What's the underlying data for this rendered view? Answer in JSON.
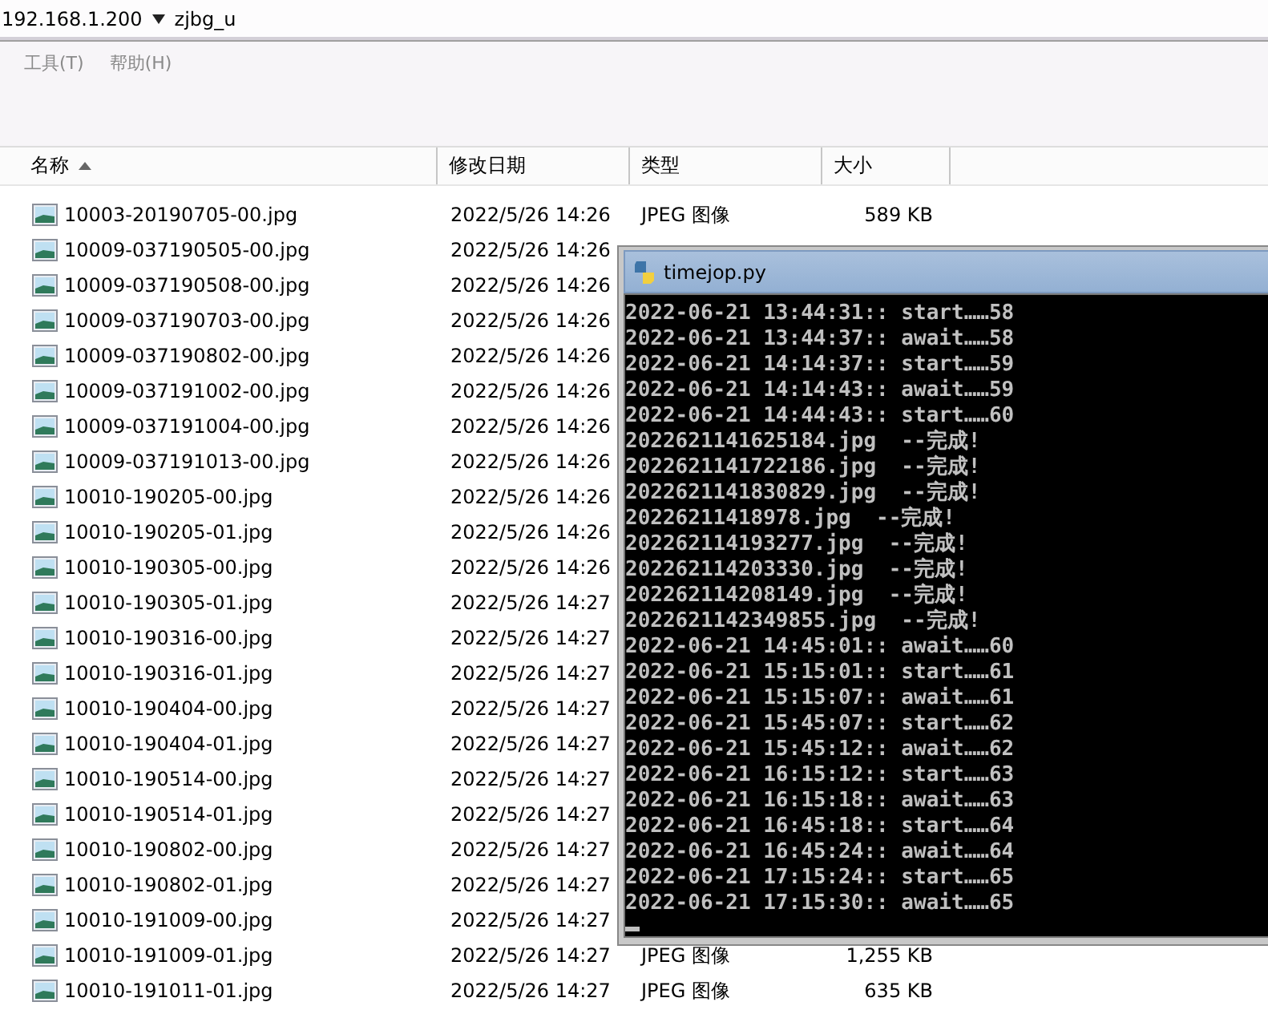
{
  "address_bar": {
    "host": "192.168.1.200",
    "folder": "zjbg_u"
  },
  "menu": [
    {
      "label": "工具(T)",
      "disabled": true
    },
    {
      "label": "帮助(H)",
      "disabled": true
    }
  ],
  "columns": [
    {
      "label": "名称",
      "sorted_ascending": true
    },
    {
      "label": "修改日期"
    },
    {
      "label": "类型"
    },
    {
      "label": "大小"
    }
  ],
  "rows": [
    {
      "name": "10003-20190705-00.jpg",
      "date": "2022/5/26 14:26",
      "type": "JPEG 图像",
      "size": "589 KB"
    },
    {
      "name": "10009-037190505-00.jpg",
      "date": "2022/5/26 14:26"
    },
    {
      "name": "10009-037190508-00.jpg",
      "date": "2022/5/26 14:26"
    },
    {
      "name": "10009-037190703-00.jpg",
      "date": "2022/5/26 14:26"
    },
    {
      "name": "10009-037190802-00.jpg",
      "date": "2022/5/26 14:26"
    },
    {
      "name": "10009-037191002-00.jpg",
      "date": "2022/5/26 14:26"
    },
    {
      "name": "10009-037191004-00.jpg",
      "date": "2022/5/26 14:26"
    },
    {
      "name": "10009-037191013-00.jpg",
      "date": "2022/5/26 14:26"
    },
    {
      "name": "10010-190205-00.jpg",
      "date": "2022/5/26 14:26"
    },
    {
      "name": "10010-190205-01.jpg",
      "date": "2022/5/26 14:26"
    },
    {
      "name": "10010-190305-00.jpg",
      "date": "2022/5/26 14:26"
    },
    {
      "name": "10010-190305-01.jpg",
      "date": "2022/5/26 14:27"
    },
    {
      "name": "10010-190316-00.jpg",
      "date": "2022/5/26 14:27"
    },
    {
      "name": "10010-190316-01.jpg",
      "date": "2022/5/26 14:27"
    },
    {
      "name": "10010-190404-00.jpg",
      "date": "2022/5/26 14:27"
    },
    {
      "name": "10010-190404-01.jpg",
      "date": "2022/5/26 14:27"
    },
    {
      "name": "10010-190514-00.jpg",
      "date": "2022/5/26 14:27"
    },
    {
      "name": "10010-190514-01.jpg",
      "date": "2022/5/26 14:27"
    },
    {
      "name": "10010-190802-00.jpg",
      "date": "2022/5/26 14:27"
    },
    {
      "name": "10010-190802-01.jpg",
      "date": "2022/5/26 14:27"
    },
    {
      "name": "10010-191009-00.jpg",
      "date": "2022/5/26 14:27"
    },
    {
      "name": "10010-191009-01.jpg",
      "date": "2022/5/26 14:27",
      "type": "JPEG 图像",
      "size": "1,255 KB"
    },
    {
      "name": "10010-191011-01.jpg",
      "date": "2022/5/26 14:27",
      "type": "JPEG 图像",
      "size": "635 KB"
    }
  ],
  "console": {
    "title": "timejop.py",
    "lines": [
      "2022-06-21 13:44:31:: start……58",
      "2022-06-21 13:44:37:: await……58",
      "2022-06-21 14:14:37:: start……59",
      "2022-06-21 14:14:43:: await……59",
      "2022-06-21 14:44:43:: start……60",
      "2022621141625184.jpg  --完成!",
      "2022621141722186.jpg  --完成!",
      "2022621141830829.jpg  --完成!",
      "20226211418978.jpg  --完成!",
      "202262114193277.jpg  --完成!",
      "202262114203330.jpg  --完成!",
      "202262114208149.jpg  --完成!",
      "2022621142349855.jpg  --完成!",
      "2022-06-21 14:45:01:: await……60",
      "2022-06-21 15:15:01:: start……61",
      "2022-06-21 15:15:07:: await……61",
      "2022-06-21 15:45:07:: start……62",
      "2022-06-21 15:45:12:: await……62",
      "2022-06-21 16:15:12:: start……63",
      "2022-06-21 16:15:18:: await……63",
      "2022-06-21 16:45:18:: start……64",
      "2022-06-21 16:45:24:: await……64",
      "2022-06-21 17:15:24:: start……65",
      "2022-06-21 17:15:30:: await……65"
    ]
  }
}
